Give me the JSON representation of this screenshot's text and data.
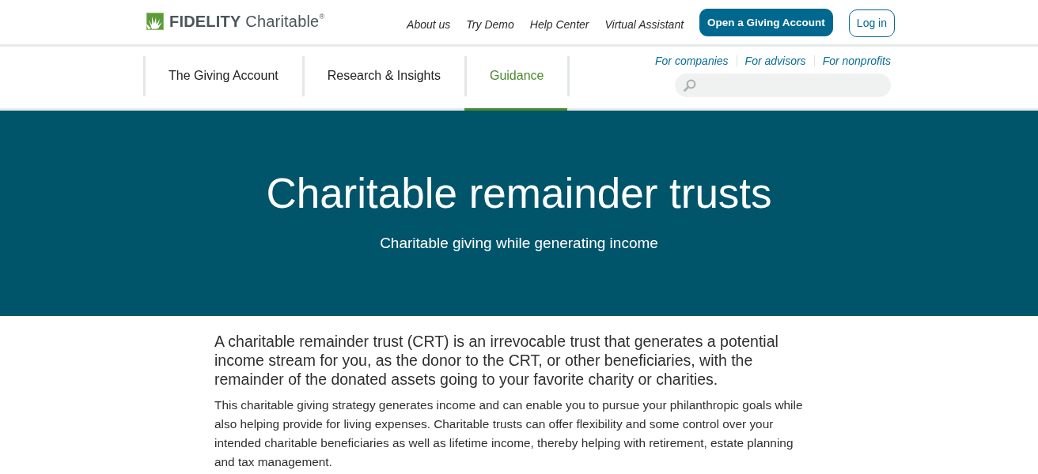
{
  "header": {
    "logo": {
      "text": "**FIDELITY** Charitable$^{®}$"
    },
    "links": [
      "About us",
      "Try Demo",
      "Help Center",
      "Virtual Assistant"
    ],
    "buttons": [
      {
        "label": "Open a Giving Account",
        "kind": "primary"
      },
      {
        "label": "Log in",
        "kind": "outline"
      }
    ]
  },
  "nav": {
    "tabs": [
      {
        "label": "The Giving Account",
        "selected": false
      },
      {
        "label": "Research & Insights",
        "selected": false
      },
      {
        "label": "Guidance",
        "selected": true
      }
    ],
    "audience_links": [
      "For companies",
      "For advisors",
      "For nonprofits"
    ]
  },
  "hero": {
    "title": "Charitable remainder trusts",
    "subtitle": "Charitable giving while generating income"
  },
  "article": {
    "lead": "A charitable remainder trust (CRT) is an irrevocable trust that generates a potential income stream for you, as the donor to the CRT, or other beneficiaries, with the remainder of the donated assets going to your favorite charity or charities.",
    "body": "This charitable giving strategy generates income and can enable you to pursue your philanthropic goals while also helping provide for living expenses. Charitable trusts can offer flexibility and some control over your intended charitable beneficiaries as well as lifetime income, thereby helping with retirement, estate planning and tax management."
  }
}
